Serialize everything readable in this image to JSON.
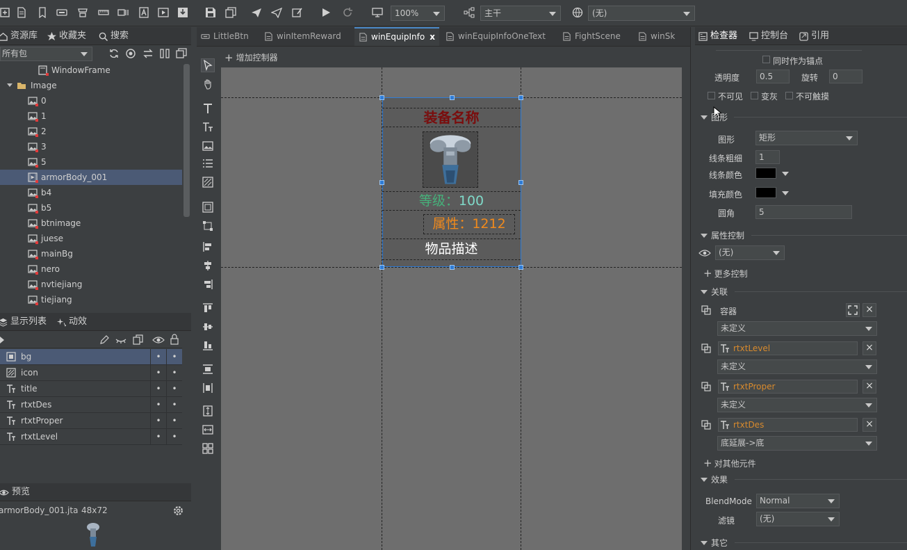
{
  "toolbar": {
    "zoom": "100%",
    "branch": "主干",
    "language": "(无)",
    "icons": [
      "new-icon",
      "doc-icon",
      "bookmark-icon",
      "minus-box-icon",
      "bucket-icon",
      "ruler-icon",
      "split-icon",
      "font-icon",
      "play-box-icon",
      "download-icon",
      "save-icon",
      "save-all-icon",
      "send-icon",
      "send-outline-icon",
      "edit-box-icon",
      "play-icon",
      "refresh-icon",
      "monitor-icon",
      "branch-icon",
      "globe-icon"
    ]
  },
  "left_tabs": {
    "library": "资源库",
    "favorites": "收藏夹",
    "search": "搜索"
  },
  "package_filter": "所有包",
  "tree": [
    {
      "label": "WindowFrame",
      "kind": "window"
    },
    {
      "label": "Image",
      "kind": "folder"
    },
    {
      "label": "0",
      "kind": "image"
    },
    {
      "label": "1",
      "kind": "image"
    },
    {
      "label": "2",
      "kind": "image"
    },
    {
      "label": "3",
      "kind": "image"
    },
    {
      "label": "5",
      "kind": "image"
    },
    {
      "label": "armorBody_001",
      "kind": "movie",
      "selected": true
    },
    {
      "label": "b4",
      "kind": "image"
    },
    {
      "label": "b5",
      "kind": "image"
    },
    {
      "label": "btnimage",
      "kind": "image"
    },
    {
      "label": "juese",
      "kind": "image"
    },
    {
      "label": "mainBg",
      "kind": "image"
    },
    {
      "label": "nero",
      "kind": "image"
    },
    {
      "label": "nvtiejiang",
      "kind": "image"
    },
    {
      "label": "tiejiang",
      "kind": "image"
    }
  ],
  "display_tabs": {
    "display_list": "显示列表",
    "effects": "动效"
  },
  "display_list": [
    {
      "label": "bg",
      "kind": "graph",
      "selected": true
    },
    {
      "label": "icon",
      "kind": "loader"
    },
    {
      "label": "title",
      "kind": "text"
    },
    {
      "label": "rtxtDes",
      "kind": "text"
    },
    {
      "label": "rtxtProper",
      "kind": "text"
    },
    {
      "label": "rtxtLevel",
      "kind": "text"
    }
  ],
  "dot": "•",
  "preview": {
    "title": "预览",
    "file": "armorBody_001.jta",
    "size": "48x72"
  },
  "doc_tabs": [
    "LittleBtn",
    "winItemReward",
    "winEquipInfo",
    "winEquipInfoOneText",
    "FightScene",
    "winSk"
  ],
  "active_doc_tab": "winEquipInfo",
  "close_x": "x",
  "add_controller": "增加控制器",
  "canvas": {
    "title": "装备名称",
    "level": "等级：100",
    "proper": "属性：1212",
    "desc": "物品描述",
    "colors": {
      "title": "#7a0d0d",
      "level_label": "#46b07a",
      "level_value": "#7fd9c8",
      "proper": "#f08a1c",
      "desc": "#ffffff"
    }
  },
  "right_tabs": {
    "inspector": "检查器",
    "console": "控制台",
    "reference": "引用"
  },
  "inspector": {
    "anchor": "同时作为锚点",
    "alpha_label": "透明度",
    "alpha": "0.5",
    "rotation_label": "旋转",
    "rotation": "0",
    "invisible": "不可见",
    "grayed": "变灰",
    "untouchable": "不可触摸",
    "graph_section": "图形",
    "shape_label": "图形",
    "shape": "矩形",
    "line_size_label": "线条粗细",
    "line_size": "1",
    "line_color_label": "线条颜色",
    "line_color": "#000000",
    "fill_color_label": "填充颜色",
    "fill_color": "#000000",
    "corner_label": "圆角",
    "corner": "5",
    "prop_ctrl_section": "属性控制",
    "prop_ctrl_value": "(无)",
    "more_ctrl": "更多控制",
    "relation_section": "关联",
    "relations": [
      {
        "target": "容器",
        "type": "未定义",
        "highlight": false
      },
      {
        "target": "rtxtLevel",
        "type": "未定义",
        "highlight": true
      },
      {
        "target": "rtxtProper",
        "type": "未定义",
        "highlight": true
      },
      {
        "target": "rtxtDes",
        "type": "底延展->底",
        "highlight": true
      }
    ],
    "add_relation": "对其他元件",
    "effect_section": "效果",
    "blend_label": "BlendMode",
    "blend": "Normal",
    "filter_label": "滤镜",
    "filter": "(无)",
    "other_section": "其它",
    "close_x": "×"
  }
}
